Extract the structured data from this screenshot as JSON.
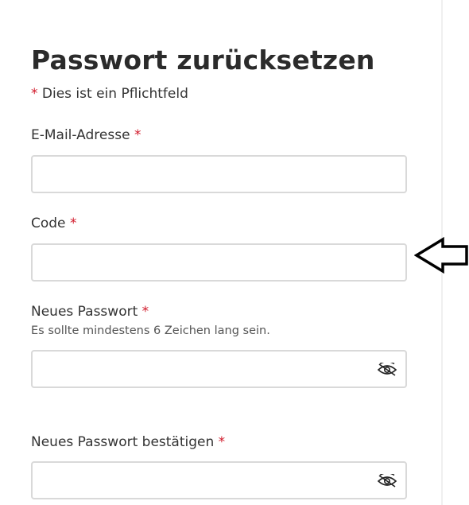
{
  "page": {
    "title": "Passwort zurücksetzen",
    "required_note_star": "*",
    "required_note_text": " Dies ist ein Pflichtfeld"
  },
  "form": {
    "email": {
      "label": "E-Mail-Adresse",
      "star": "*",
      "value": ""
    },
    "code": {
      "label": "Code",
      "star": "*",
      "value": ""
    },
    "new_password": {
      "label": "Neues Passwort",
      "star": "*",
      "hint": "Es sollte mindestens 6 Zeichen lang sein.",
      "value": "",
      "toggle_icon": "eye-slash-icon"
    },
    "confirm_password": {
      "label": "Neues Passwort bestätigen",
      "star": "*",
      "value": "",
      "toggle_icon": "eye-slash-icon"
    }
  },
  "annotation": {
    "icon": "arrow-left-outline-icon"
  },
  "colors": {
    "required_star": "#d1192a",
    "input_border": "#d9d9d9",
    "text": "#333333"
  }
}
